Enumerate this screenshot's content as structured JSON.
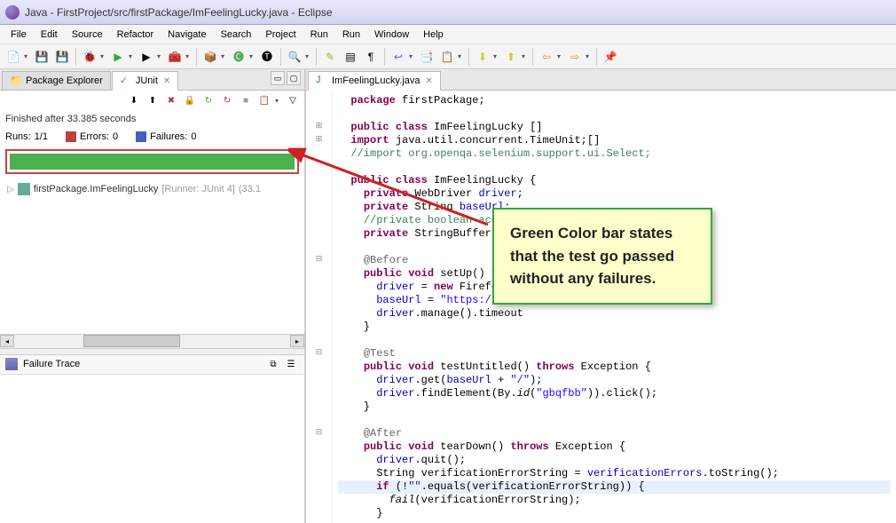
{
  "window": {
    "title": "Java - FirstProject/src/firstPackage/ImFeelingLucky.java - Eclipse"
  },
  "menus": [
    "File",
    "Edit",
    "Source",
    "Refactor",
    "Navigate",
    "Search",
    "Project",
    "Run",
    "Run",
    "Window",
    "Help"
  ],
  "left": {
    "tabs": [
      {
        "label": "Package Explorer",
        "active": false
      },
      {
        "label": "JUnit",
        "active": true
      }
    ],
    "status": "Finished after 33.385 seconds",
    "runs": {
      "label": "Runs:",
      "value": "1/1"
    },
    "errors": {
      "label": "Errors:",
      "value": "0"
    },
    "failures": {
      "label": "Failures:",
      "value": "0"
    },
    "tree_item": {
      "name": "firstPackage.ImFeelingLucky",
      "runner": "[Runner: JUnit 4]",
      "time": "(33.1"
    },
    "failure_trace_label": "Failure Trace"
  },
  "editor": {
    "tab": {
      "label": "ImFeelingLucky.java"
    },
    "lines": [
      {
        "type": "code",
        "html": "<span class='kw'>package</span> firstPackage;"
      },
      {
        "type": "blank"
      },
      {
        "type": "fold",
        "icon": "+",
        "html": "<span class='kw'>public</span> <span class='kw'>class</span> ImFeelingLucky []"
      },
      {
        "type": "fold",
        "icon": "+",
        "html": "<span class='kw'>import</span> java.util.concurrent.TimeUnit;[]"
      },
      {
        "type": "code",
        "html": "<span class='cm'>//import org.openqa.selenium.support.ui.Select;</span>"
      },
      {
        "type": "blank"
      },
      {
        "type": "code",
        "html": "<span class='kw'>public</span> <span class='kw'>class</span> ImFeelingLucky {"
      },
      {
        "type": "code",
        "html": "  <span class='kw'>private</span> WebDriver <span class='fld'>driver</span>;"
      },
      {
        "type": "code",
        "html": "  <span class='kw'>private</span> String <span class='fld'>baseUrl</span>;"
      },
      {
        "type": "code",
        "html": "  <span class='cm'>//private boolean acceptN</span>"
      },
      {
        "type": "code",
        "html": "  <span class='kw'>private</span> StringBuffer <span class='fld'>veri</span>"
      },
      {
        "type": "blank"
      },
      {
        "type": "fold",
        "icon": "-",
        "html": "  <span class='ann'>@Before</span>"
      },
      {
        "type": "code",
        "html": "  <span class='kw'>public</span> <span class='kw'>void</span> setUp() <span class='kw'>throw</span>"
      },
      {
        "type": "code",
        "html": "    <span class='fld'>driver</span> = <span class='kw'>new</span> FirefoxDri"
      },
      {
        "type": "code",
        "html": "    <span class='fld'>baseUrl</span> = <span class='str'>\"https://www.</span>"
      },
      {
        "type": "code",
        "html": "    <span class='fld'>driver</span>.manage().timeout"
      },
      {
        "type": "code",
        "html": "  }"
      },
      {
        "type": "blank"
      },
      {
        "type": "fold",
        "icon": "-",
        "html": "  <span class='ann'>@Test</span>"
      },
      {
        "type": "code",
        "html": "  <span class='kw'>public</span> <span class='kw'>void</span> testUntitled() <span class='kw'>throws</span> Exception {"
      },
      {
        "type": "code",
        "html": "    <span class='fld'>driver</span>.get(<span class='fld'>baseUrl</span> + <span class='str'>\"/\"</span>);"
      },
      {
        "type": "code",
        "html": "    <span class='fld'>driver</span>.findElement(By.<span class='stat-call'>id</span>(<span class='str'>\"gbqfbb\"</span>)).click();"
      },
      {
        "type": "code",
        "html": "  }"
      },
      {
        "type": "blank"
      },
      {
        "type": "fold",
        "icon": "-",
        "html": "  <span class='ann'>@After</span>"
      },
      {
        "type": "code",
        "html": "  <span class='kw'>public</span> <span class='kw'>void</span> tearDown() <span class='kw'>throws</span> Exception {"
      },
      {
        "type": "code",
        "html": "    <span class='fld'>driver</span>.quit();"
      },
      {
        "type": "code",
        "html": "    String verificationErrorString = <span class='fld'>verificationErrors</span>.toString();"
      },
      {
        "type": "code",
        "hl": true,
        "html": "    <span class='kw'>if</span> (!<span class='str'>\"\"</span>.equals(verificationErrorString)) {"
      },
      {
        "type": "code",
        "html": "      <span class='stat-call'>fail</span>(verificationErrorString);"
      },
      {
        "type": "code",
        "html": "    }"
      }
    ]
  },
  "callout": {
    "text": "Green Color bar states that the test go passed without any failures."
  },
  "colors": {
    "green_bar": "#4CAF50",
    "highlight_border": "#d04040",
    "callout_bg": "#ffffcc",
    "callout_border": "#33aa33"
  }
}
